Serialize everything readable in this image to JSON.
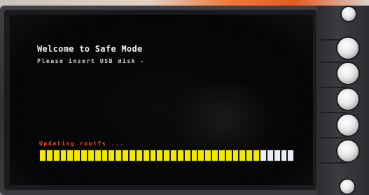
{
  "screen": {
    "title": "Welcome to Safe Mode",
    "message": "Please insert USB disk -",
    "status": "Updating rootfs ...",
    "progress": {
      "filled_segments": 32,
      "total_segments": 37,
      "fill_color": "#f2e800",
      "empty_color": "#e8eef4"
    }
  },
  "device": {
    "side_buttons": [
      {
        "name": "side-button-1"
      },
      {
        "name": "side-button-2"
      },
      {
        "name": "side-button-3"
      },
      {
        "name": "side-button-4"
      },
      {
        "name": "side-button-5"
      },
      {
        "name": "side-button-6"
      },
      {
        "name": "side-button-7"
      }
    ]
  }
}
